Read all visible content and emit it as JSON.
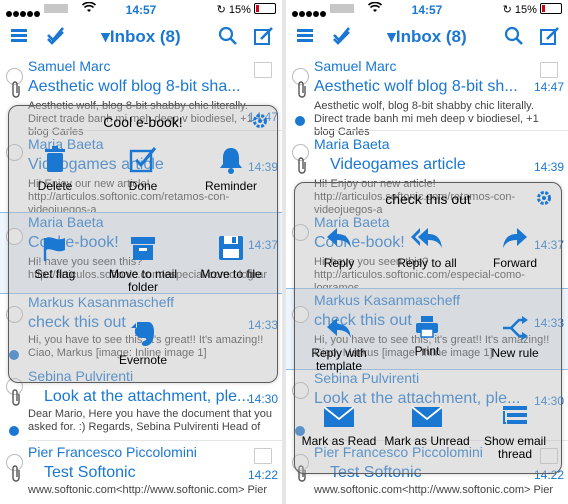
{
  "status": {
    "time": "14:57",
    "battery": "15%"
  },
  "navbar": {
    "title": "Inbox (8)"
  },
  "left": {
    "emails": [
      {
        "sender": "Samuel Marc",
        "subject": "Aesthetic wolf blog 8-bit sha...",
        "time": "14:47",
        "snippet": "Aesthetic wolf, blog 8-bit shabby chic literally. Direct trade banh mi meh deep v biodiesel, +1 blog Carles"
      },
      {
        "sender": "Maria Baeta",
        "subject": "Videogames article",
        "time": "14:39",
        "snippet": "Hi! Enjoy our new article! http://articulos.softonic.com/retamos-con-videojuegos-a"
      },
      {
        "sender": "Maria Baeta",
        "subject": "Cool e-book!",
        "time": "14:37",
        "snippet": "Hi! have you seen this? http://articulos.softonic.com/especial-como-lograr"
      },
      {
        "sender": "Markus Kasanmascheff",
        "subject": "check this out",
        "time": "14:33",
        "snippet": "Hi, you have to see this, it's great!! It's amazing!! Ciao, Markus [image: Inline image 1]"
      },
      {
        "sender": "Sebina Pulvirenti",
        "subject": "Look at the attachment, ple...",
        "time": "14:30",
        "snippet": "Dear Mario, Here you have the document that you asked for. :) Regards, Sebina Pulvirenti Head of"
      },
      {
        "sender": "Pier Francesco Piccolomini",
        "subject": "Test Softonic",
        "time": "14:22",
        "snippet": "www.softonic.com<http://www.softonic.com> Pier"
      }
    ],
    "menu": {
      "title": "Cool e-book!",
      "actions": [
        "Delete",
        "Done",
        "Reminder",
        "Set flag",
        "Move to mail folder",
        "Move to file",
        "Evernote"
      ]
    }
  },
  "right": {
    "emails": [
      {
        "sender": "Samuel Marc",
        "subject": "Aesthetic wolf blog 8-bit sh...",
        "time": "14:47",
        "snippet": "Aesthetic wolf, blog 8-bit shabby chic literally. Direct trade banh mi meh deep v biodiesel, +1 blog Carles"
      },
      {
        "sender": "Maria Baeta",
        "subject": "Videogames article",
        "time": "14:39",
        "snippet": "Hi! Enjoy our new article! http://articulos.softonic.com/retamos-con-videojuegos-a"
      },
      {
        "sender": "Maria Baeta",
        "subject": "Cool e-book!",
        "time": "14:37",
        "snippet": "Hi! have you seen this? http://articulos.softonic.com/especial-como-logramos"
      },
      {
        "sender": "Markus Kasanmascheff",
        "subject": "check this out",
        "time": "14:33",
        "snippet": "Hi, you have to see this, it's great!! It's amazing!! Ciao, Markus [image: Inline image 1]"
      },
      {
        "sender": "Sebina Pulvirenti",
        "subject": "Look at the attachment, ple...",
        "time": "14:30",
        "snippet": ""
      },
      {
        "sender": "Pier Francesco Piccolomini",
        "subject": "Test Softonic",
        "time": "14:22",
        "snippet": "www.softonic.com<http://www.softonic.com> Pier"
      }
    ],
    "menu": {
      "title": "check this out",
      "actions": [
        "Reply",
        "Reply to all",
        "Forward",
        "Reply with template",
        "Print",
        "New rule",
        "Mark as Read",
        "Mark as Unread",
        "Show email thread"
      ]
    }
  },
  "colors": {
    "accent": "#1a77d2",
    "text": "#000000"
  }
}
